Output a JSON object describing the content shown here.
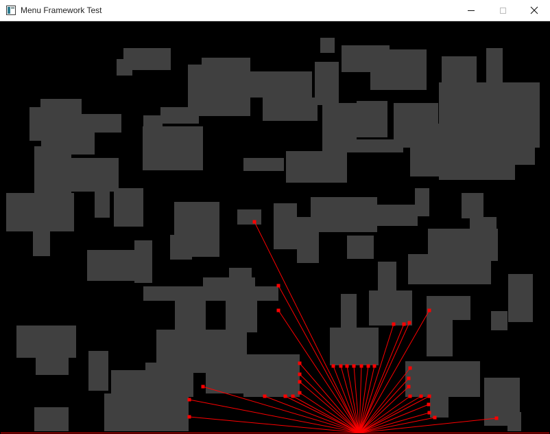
{
  "window": {
    "title": "Menu Framework Test",
    "icons": {
      "app": "app-icon",
      "minimize": "minimize-icon",
      "maximize": "maximize-icon",
      "close": "close-icon"
    }
  },
  "scene": {
    "background_color": "#000000",
    "obstacle_color": "#404040",
    "ray_color": "#ff0000",
    "hit_marker_color": "#ff0000"
  }
}
